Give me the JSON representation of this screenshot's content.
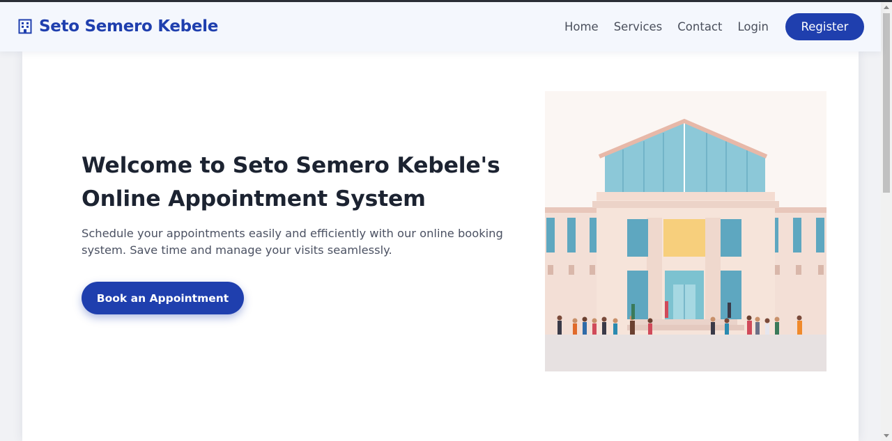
{
  "navbar": {
    "brand": {
      "icon": "building-icon",
      "name": "Seto Semero Kebele"
    },
    "links": [
      "Home",
      "Services",
      "Contact",
      "Login"
    ],
    "register_label": "Register"
  },
  "hero": {
    "title_line1": "Welcome to Seto Semero Kebele's",
    "title_line2": "Online Appointment System",
    "description": "Schedule your appointments easily and efficiently with our online booking system. Save time and manage your visits seamlessly.",
    "cta_label": "Book an Appointment",
    "image": "government-building-illustration"
  },
  "colors": {
    "brand": "#1f3fae",
    "heading": "#1c2331",
    "body_text": "#4b5162",
    "nav_bg": "#f4f7fd"
  }
}
